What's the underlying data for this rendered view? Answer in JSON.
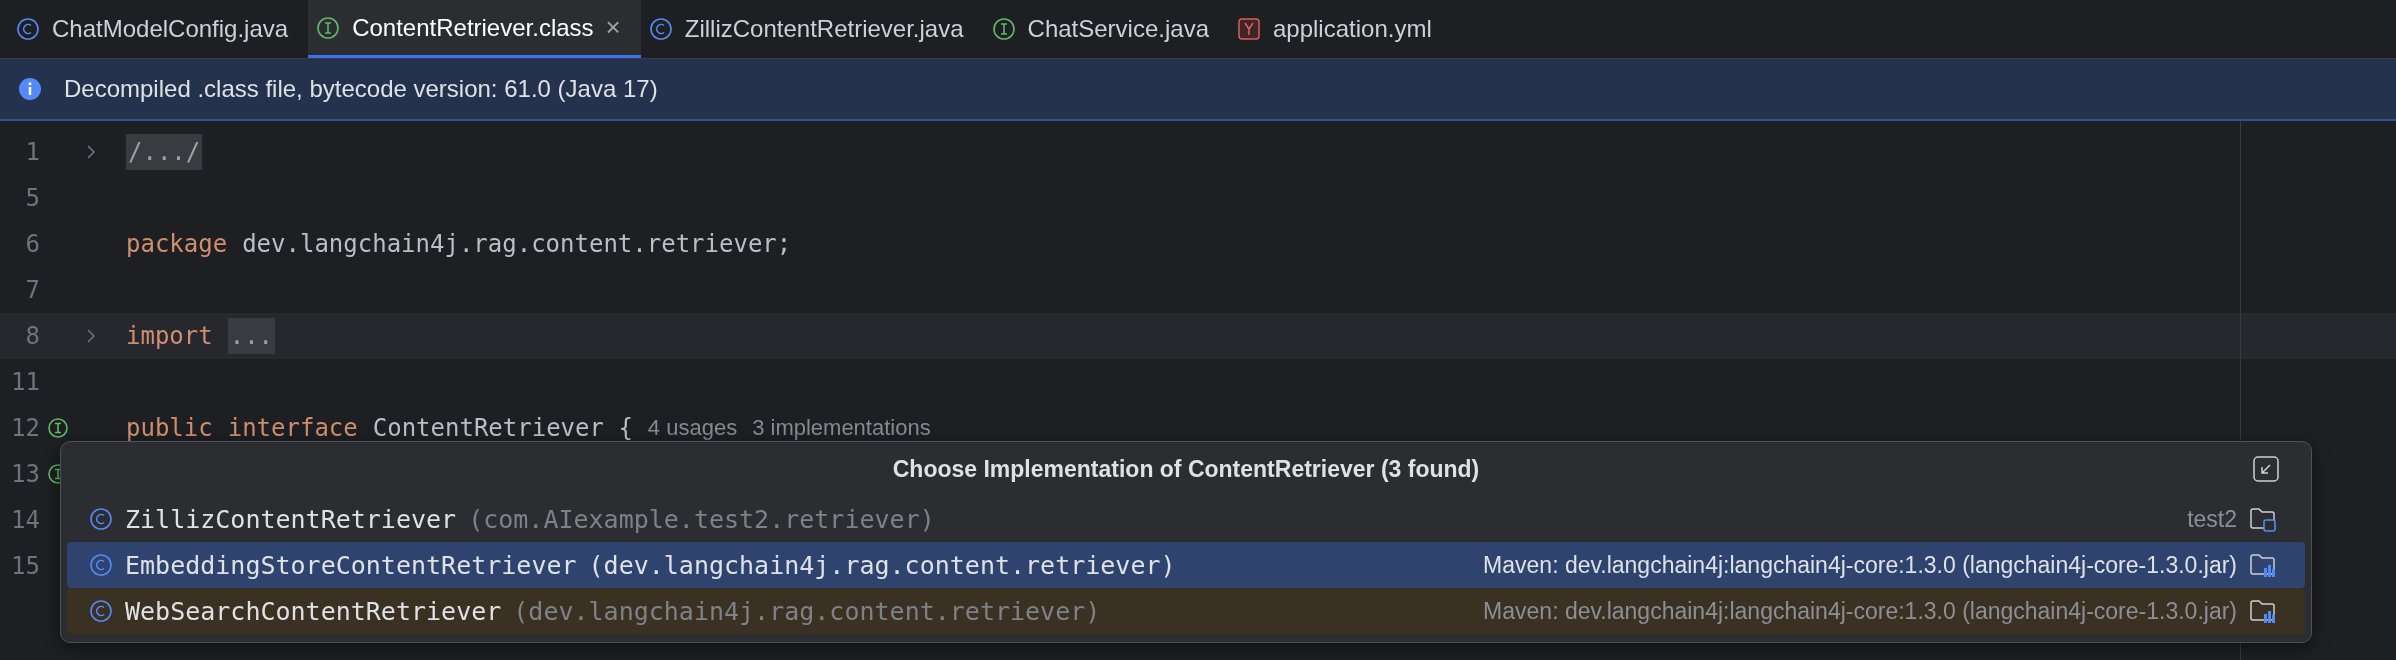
{
  "tabs": [
    {
      "label": "ChatModelConfig.java",
      "kind": "class",
      "selected": false
    },
    {
      "label": "ContentRetriever.class",
      "kind": "interface",
      "selected": true,
      "close": "×"
    },
    {
      "label": "ZillizContentRetriever.java",
      "kind": "class",
      "selected": false
    },
    {
      "label": "ChatService.java",
      "kind": "interface",
      "selected": false
    },
    {
      "label": "application.yml",
      "kind": "yaml",
      "selected": false
    }
  ],
  "info_bar": {
    "text": "Decompiled .class file, bytecode version: 61.0 (Java 17)"
  },
  "editor": {
    "lines": [
      {
        "number": "1",
        "fold": true,
        "current": false,
        "tokens": [
          {
            "kind": "folded",
            "text": "/.../"
          }
        ]
      },
      {
        "number": "5",
        "current": false
      },
      {
        "number": "6",
        "current": false,
        "tokens": [
          {
            "kind": "keyword",
            "text": "package"
          },
          {
            "kind": "plain",
            "text": "dev.langchain4j.rag.content.retriever;"
          }
        ]
      },
      {
        "number": "7",
        "current": false
      },
      {
        "number": "8",
        "fold": true,
        "current": true,
        "tokens": [
          {
            "kind": "keyword",
            "text": "import"
          },
          {
            "kind": "folded",
            "text": "..."
          }
        ]
      },
      {
        "number": "11",
        "current": false
      },
      {
        "number": "12",
        "marker": true,
        "current": false,
        "tokens": [
          {
            "kind": "keyword",
            "text": "public"
          },
          {
            "kind": "keyword",
            "text": "interface"
          },
          {
            "kind": "plain",
            "text": "ContentRetriever {"
          },
          {
            "kind": "hint",
            "text": "4 usages"
          },
          {
            "kind": "hint",
            "text": "3 implementations"
          }
        ]
      },
      {
        "number": "13",
        "marker": true,
        "current": false
      },
      {
        "number": "14",
        "current": false
      },
      {
        "number": "15",
        "current": false
      }
    ]
  },
  "popup": {
    "title": "Choose Implementation of ContentRetriever (3 found)",
    "items": [
      {
        "name": "ZillizContentRetriever",
        "package": "(com.AIexample.test2.retriever)",
        "location": "test2",
        "kind": "project",
        "selected": false
      },
      {
        "name": "EmbeddingStoreContentRetriever",
        "package": "(dev.langchain4j.rag.content.retriever)",
        "location": "Maven: dev.langchain4j:langchain4j-core:1.3.0 (langchain4j-core-1.3.0.jar)",
        "kind": "library",
        "selected": true
      },
      {
        "name": "WebSearchContentRetriever",
        "package": "(dev.langchain4j.rag.content.retriever)",
        "location": "Maven: dev.langchain4j:langchain4j-core:1.3.0 (langchain4j-core-1.3.0.jar)",
        "kind": "library",
        "selected": false
      }
    ]
  }
}
